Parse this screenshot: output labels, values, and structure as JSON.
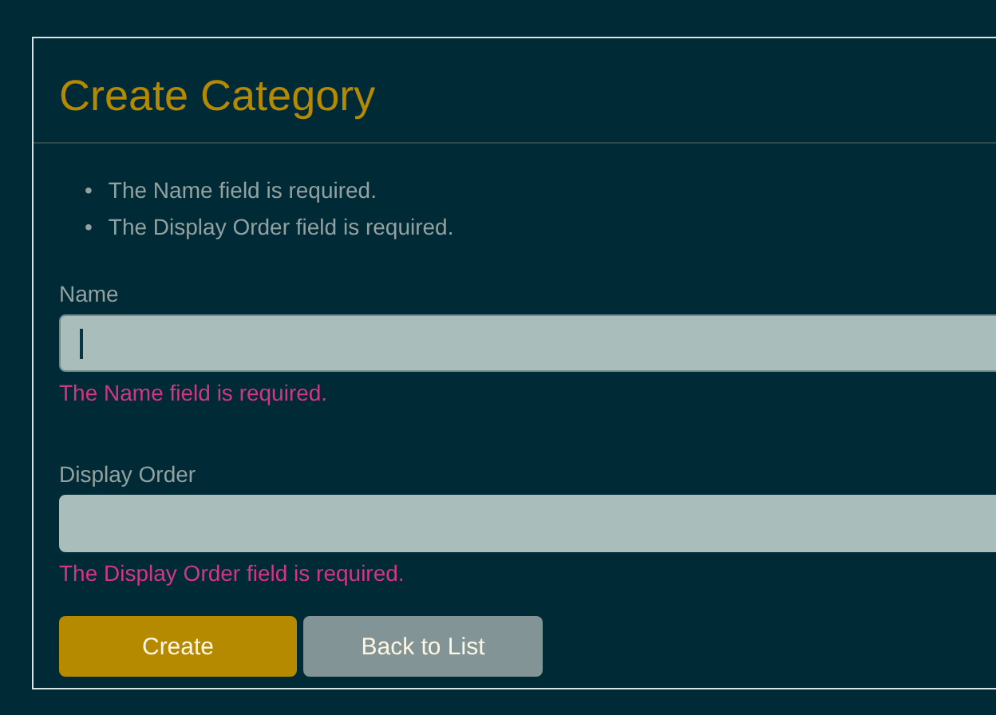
{
  "title": "Create Category",
  "summary_errors": [
    {
      "bullet": "•",
      "text": "The Name field is required."
    },
    {
      "bullet": "•",
      "text": "The Display Order field is required."
    }
  ],
  "fields": [
    {
      "label": "Name",
      "focused": true,
      "error": "The Name field is required."
    },
    {
      "label": "Display Order",
      "focused": false,
      "error": "The Display Order field is required."
    }
  ],
  "buttons": [
    {
      "label": "Create",
      "kind": "primary"
    },
    {
      "label": "Back to List",
      "kind": "secondary"
    }
  ]
}
